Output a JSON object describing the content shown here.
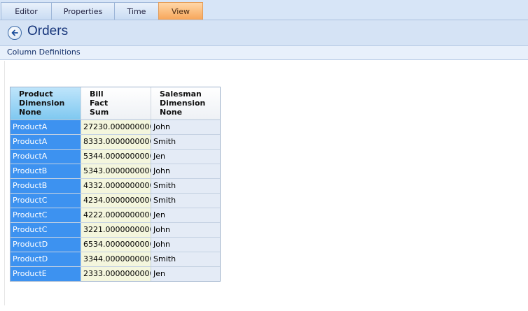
{
  "tabs": [
    {
      "label": "Editor",
      "active": false
    },
    {
      "label": "Properties",
      "active": false
    },
    {
      "label": "Time",
      "active": false
    },
    {
      "label": "View",
      "active": true
    }
  ],
  "header": {
    "title": "Orders",
    "back_icon": "back-arrow-icon"
  },
  "section": {
    "label": "Column Definitions"
  },
  "grid": {
    "columns": [
      {
        "line1": "Product",
        "line2": "Dimension",
        "line3": "None",
        "selected": true
      },
      {
        "line1": "Bill",
        "line2": "Fact",
        "line3": "Sum",
        "selected": false
      },
      {
        "line1": "Salesman",
        "line2": "Dimension",
        "line3": "None",
        "selected": false
      }
    ],
    "rows": [
      [
        "ProductA",
        "27230.0000000000",
        "John"
      ],
      [
        "ProductA",
        "8333.00000000000",
        "Smith"
      ],
      [
        "ProductA",
        "5344.00000000000",
        "Jen"
      ],
      [
        "ProductB",
        "5343.00000000000",
        "John"
      ],
      [
        "ProductB",
        "4332.00000000000",
        "Smith"
      ],
      [
        "ProductC",
        "4234.00000000000",
        "Smith"
      ],
      [
        "ProductC",
        "4222.00000000000",
        "Jen"
      ],
      [
        "ProductC",
        "3221.00000000000",
        "John"
      ],
      [
        "ProductD",
        "6534.00000000000",
        "John"
      ],
      [
        "ProductD",
        "3344.00000000000",
        "Smith"
      ],
      [
        "ProductE",
        "2333.00000000000",
        "Jen"
      ]
    ]
  },
  "colors": {
    "accent_tab": "#f7a65a",
    "selected_column": "#3d92f0",
    "title": "#16357a"
  }
}
